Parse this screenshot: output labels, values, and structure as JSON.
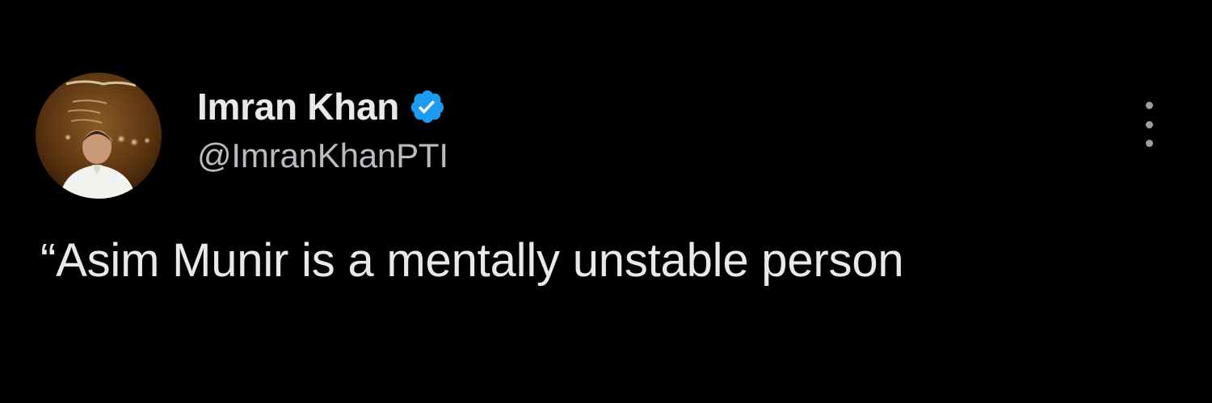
{
  "tweet": {
    "author": {
      "display_name": "Imran Khan",
      "handle": "@ImranKhanPTI",
      "verified": true,
      "verified_badge_icon": "verified-badge-icon",
      "verified_color": "#1d9bf0"
    },
    "more_icon": "more-options-icon",
    "text": "“Asim Munir is a mentally unstable person"
  },
  "colors": {
    "background": "#000000",
    "primary_text": "#e7e9ea",
    "secondary_text": "#b9bdc1"
  }
}
